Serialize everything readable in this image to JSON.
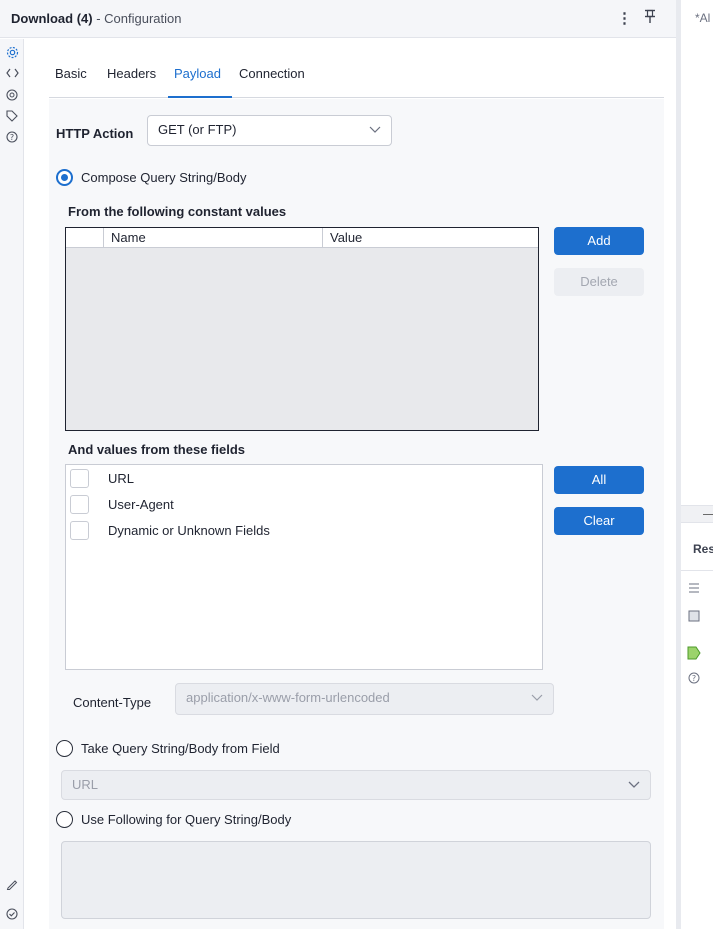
{
  "header": {
    "title": "Download (4)",
    "subtitle": " - Configuration",
    "menu_glyph": "⋮",
    "pin_glyph": "ㄧ"
  },
  "right_panel": {
    "tab_text": "*Al",
    "results_label": "Res"
  },
  "tabs": [
    {
      "label": "Basic",
      "active": false
    },
    {
      "label": "Headers",
      "active": false
    },
    {
      "label": "Payload",
      "active": true
    },
    {
      "label": "Connection",
      "active": false
    }
  ],
  "http_action": {
    "label": "HTTP Action",
    "value": "GET (or FTP)"
  },
  "compose": {
    "label": "Compose Query String/Body",
    "checked": true,
    "constants_label": "From the following constant values",
    "columns": [
      "Name",
      "Value"
    ],
    "rows": [],
    "add_label": "Add",
    "delete_label": "Delete"
  },
  "fields": {
    "label": "And values from these fields",
    "items": [
      {
        "label": "URL",
        "checked": false
      },
      {
        "label": "User-Agent",
        "checked": false
      },
      {
        "label": "Dynamic or Unknown Fields",
        "checked": false
      }
    ],
    "all_label": "All",
    "clear_label": "Clear"
  },
  "content_type": {
    "label": "Content-Type",
    "value": "application/x-www-form-urlencoded"
  },
  "take_from_field": {
    "label": "Take Query String/Body from Field",
    "checked": false,
    "value": "URL"
  },
  "use_following": {
    "label": "Use Following for Query String/Body",
    "checked": false,
    "value": ""
  },
  "colors": {
    "accent": "#1d6fce",
    "panel_bg": "#f7f8fa"
  }
}
